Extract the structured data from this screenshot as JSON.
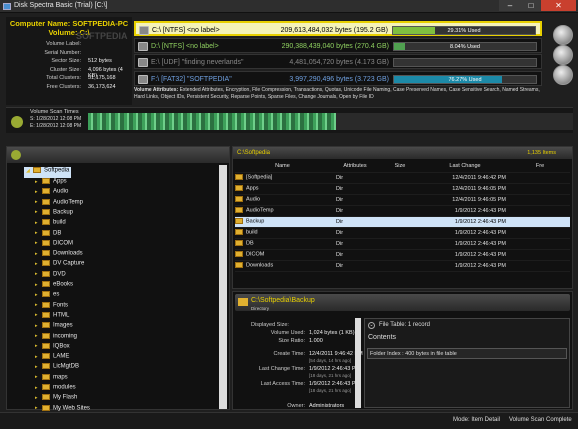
{
  "window": {
    "title": "Disk Spectra Basic (Trial) [C:\\]"
  },
  "computer": {
    "name_line": "Computer Name: SOFTPEDIA-PC",
    "volume_line": "Volume: C:\\",
    "watermark": "SOFTPEDIA",
    "fields": [
      {
        "k": "Volume Label:",
        "v": ""
      },
      {
        "k": "Serial Number:",
        "v": ""
      },
      {
        "k": "Sector Size:",
        "v": "512 bytes"
      },
      {
        "k": "Cluster Size:",
        "v": "4,096 bytes (4 KB)"
      },
      {
        "k": "Total Clusters:",
        "v": "51,175,168"
      },
      {
        "k": "Free Clusters:",
        "v": "36,173,624"
      }
    ]
  },
  "volumes": [
    {
      "label": "C:\\ [NTFS] <no label>",
      "bytes": "209,613,484,032 bytes (195.2 GB)",
      "pct": "29.31% Used",
      "used": 0.2931,
      "color": "#7fbf3f"
    },
    {
      "label": "D:\\ [NTFS] <no label>",
      "bytes": "290,388,439,040 bytes (270.4 GB)",
      "pct": "8.04% Used",
      "used": 0.0804,
      "color": "#50a050"
    },
    {
      "label": "E:\\ [UDF] \"finding neverlands\"",
      "bytes": "4,481,054,720 bytes (4.173 GB)",
      "pct": "",
      "used": 0,
      "color": "#555"
    },
    {
      "label": "F:\\ [FAT32] \"SOFTPEDIA\"",
      "bytes": "3,997,290,496 bytes (3.723 GB)",
      "pct": "76.27% Used",
      "used": 0.7627,
      "color": "#1c8aa8"
    }
  ],
  "attributes": {
    "label": "Volume Attributes:",
    "text": "Extended Attributes, Encryption, File Compression, Transactions, Quotas, Unicode File Naming, Case Preserved Names, Case Sensitive Search, Named Streams, Hard Links, Object IDs, Persistent Security, Reparse Points, Sparse Files, Change Journals, Open by File ID"
  },
  "scan": {
    "title": "Volume Scan Times",
    "s": "S: 1/28/2012 12:08 PM",
    "e": "E: 1/28/2012 12:08 PM"
  },
  "tree": {
    "root": "Softpedia",
    "items": [
      "Apps",
      "Audio",
      "AudioTemp",
      "Backup",
      "build",
      "DB",
      "DICOM",
      "Downloads",
      "DV Capture",
      "DVD",
      "eBooks",
      "es",
      "Fonts",
      "HTML",
      "Images",
      "incoming",
      "IQBox",
      "LAME",
      "LicMgtDB",
      "maps",
      "modules",
      "My Flash",
      "My Web Sites",
      "out"
    ]
  },
  "list": {
    "path": "C:\\Softpedia",
    "count": "1,135 Items",
    "cols": [
      "Name",
      "Attributes",
      "Size",
      "Last Change",
      "Fre"
    ],
    "rows": [
      [
        "[Softpedia]",
        "Dir",
        "",
        "12/4/2011 9:46:42 PM"
      ],
      [
        "Apps",
        "Dir",
        "",
        "12/4/2011 9:46:05 PM"
      ],
      [
        "Audio",
        "Dir",
        "",
        "12/4/2011 9:46:05 PM"
      ],
      [
        "AudioTemp",
        "Dir",
        "",
        "1/9/2012 2:46:43 PM"
      ],
      [
        "Backup",
        "Dir",
        "",
        "1/9/2012 2:46:43 PM"
      ],
      [
        "build",
        "Dir",
        "",
        "1/9/2012 2:46:43 PM"
      ],
      [
        "DB",
        "Dir",
        "",
        "1/9/2012 2:46:43 PM"
      ],
      [
        "DICOM",
        "Dir",
        "",
        "1/9/2012 2:46:43 PM"
      ],
      [
        "Downloads",
        "Dir",
        "",
        "1/9/2012 2:46:43 PM"
      ]
    ]
  },
  "detail": {
    "path": "C:\\Softpedia\\Backup",
    "type": "Directory",
    "displayed_size": "Displayed Size:",
    "vol_used_k": "Volume Used:",
    "vol_used": "1,024 bytes (1 KB)",
    "ratio_k": "Size Ratio:",
    "ratio": "1.000",
    "create_k": "Create Time:",
    "create": "12/4/2011 9:46:42 PM",
    "create_s": "[54 days, 14 hrs ago]",
    "change_k": "Last Change Time:",
    "change": "1/9/2012 2:46:43 PM",
    "change_s": "[18 days, 21 hrs ago]",
    "access_k": "Last Access Time:",
    "access": "1/9/2012 2:46:43 PM",
    "access_s": "[18 days, 21 hrs ago]",
    "owner_k": "Owner:",
    "owner": "Administrators",
    "ft_title": "File Table: 1 record",
    "contents": "Contents",
    "folder_index": "Folder Index : 400 bytes in file table"
  },
  "status": {
    "mode": "Mode: Item Detail",
    "scan": "Volume Scan Complete"
  }
}
